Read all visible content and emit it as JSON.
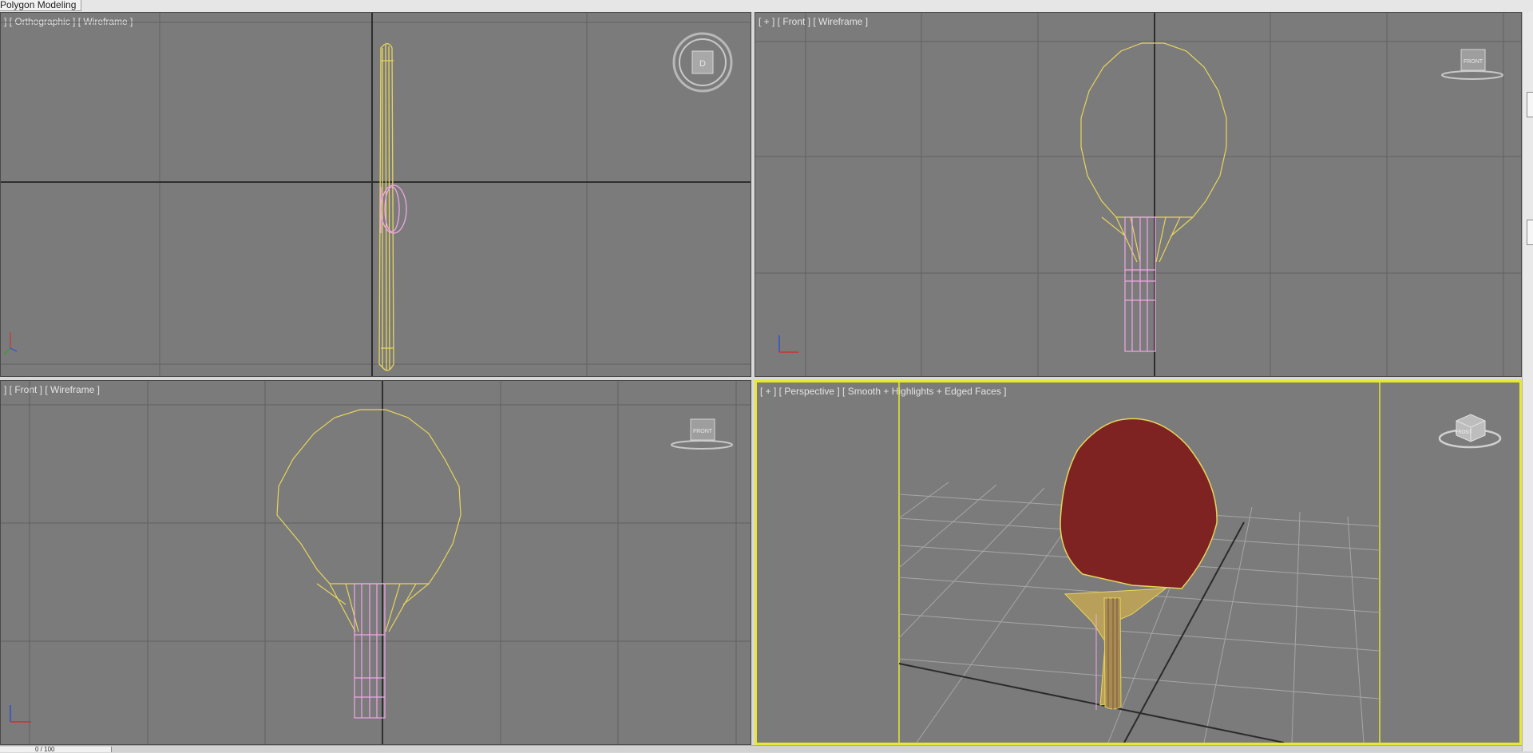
{
  "ribbon": {
    "tab_label": "Polygon Modeling"
  },
  "viewports": {
    "top_left": {
      "label": "] [ Orthographic ] [ Wireframe ]"
    },
    "top_right": {
      "label": "[ + ] [ Front ] [ Wireframe ]"
    },
    "bottom_left": {
      "label": "] [ Front ] [ Wireframe ]"
    },
    "bottom_right": {
      "label": "[ + ] [ Perspective ] [ Smooth + Highlights + Edged Faces ]"
    }
  },
  "viewcube_labels": {
    "front": "FRONT"
  },
  "statusbar": {
    "frame_field": "0 / 100"
  },
  "colors": {
    "viewport_bg": "#7b7b7b",
    "grid_line": "#626262",
    "axis_line": "#2e2e2e",
    "wire_paddle": "#e6d65a",
    "wire_handle": "#f0a6e6",
    "rubber_red": "#7e2222",
    "active_border": "#e8e832"
  }
}
